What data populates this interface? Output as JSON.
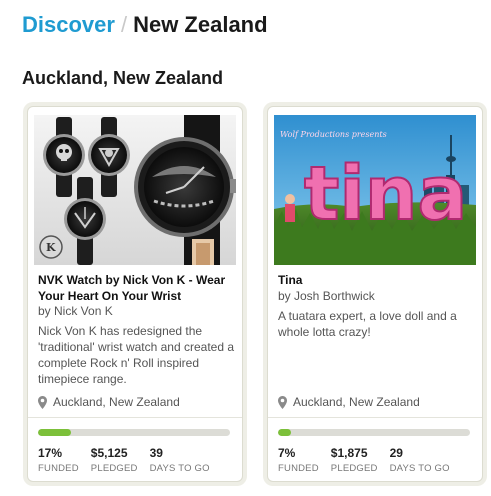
{
  "breadcrumb": {
    "parent": "Discover",
    "separator": "/",
    "current": "New Zealand"
  },
  "section": {
    "title": "Auckland, New Zealand"
  },
  "projects": [
    {
      "title": "NVK Watch by Nick Von K - Wear Your Heart On Your Wrist",
      "byline": "by Nick Von K",
      "description": "Nick Von K has redesigned the 'traditional' wrist watch and created a complete Rock n' Roll inspired timepiece range.",
      "location": "Auckland, New Zealand",
      "progress_fraction": 0.17,
      "stats": [
        {
          "value": "17%",
          "label": "FUNDED"
        },
        {
          "value": "$5,125",
          "label": "PLEDGED"
        },
        {
          "value": "39",
          "label": "DAYS TO GO"
        }
      ]
    },
    {
      "title": "Tina",
      "byline": "by Josh Borthwick",
      "description": "A tuatara expert, a love doll and a whole lotta crazy!",
      "location": "Auckland, New Zealand",
      "image_caption": "Wolf Productions presents",
      "image_title": "tina",
      "progress_fraction": 0.07,
      "stats": [
        {
          "value": "7%",
          "label": "FUNDED"
        },
        {
          "value": "$1,875",
          "label": "PLEDGED"
        },
        {
          "value": "29",
          "label": "DAYS TO GO"
        }
      ]
    }
  ],
  "colors": {
    "link": "#1f9bd1",
    "progress": "#7cc03a",
    "track": "#dcdcd6"
  },
  "icons": {
    "location": "map-pin-icon"
  }
}
